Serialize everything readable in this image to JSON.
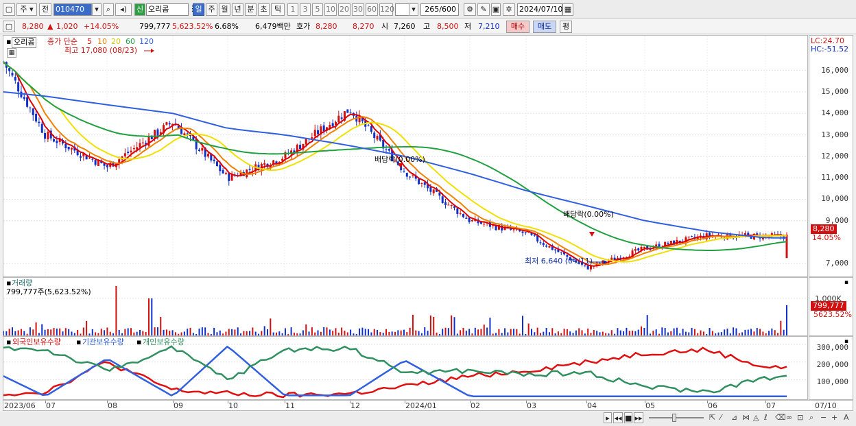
{
  "toolbar": {
    "period_mode": "주",
    "compare": "전",
    "stock_code": "010470",
    "new_badge": "신",
    "stock_name": "오리콤",
    "timeframes": [
      "일",
      "주",
      "월",
      "년",
      "분",
      "초",
      "틱"
    ],
    "minute_presets": [
      "1",
      "3",
      "5",
      "10",
      "20",
      "30",
      "60",
      "120"
    ],
    "count_display": "265",
    "count_total": "/600",
    "date": "2024/07/10"
  },
  "quote": {
    "price": "8,280",
    "change": "1,020",
    "change_pct": "+14.05%",
    "volume": "799,777",
    "volume_pct": "5,623.52%",
    "turnover_rate": "6.68%",
    "trade_value": "6,479백만",
    "ask_label": "호가",
    "ask": "8,280",
    "bid": "8,270",
    "open_label": "시",
    "open": "7,260",
    "high_label": "고",
    "high": "8,500",
    "low_label": "저",
    "low": "7,210",
    "buy_label": "매수",
    "sell_label": "매도",
    "eval_label": "평"
  },
  "price_panel": {
    "name": "오리콤",
    "ma_title": "종가 단순",
    "ma_periods": [
      "5",
      "10",
      "20",
      "60",
      "120"
    ],
    "high_annotation": "최고 17,080 (08/23)",
    "low_annotation": "최저 6,640 (04/11)",
    "dividend1": "배당락(0.00%)",
    "dividend2": "배당락(0.00%)",
    "lc_label": "LC:24.70",
    "hc_label": "HC:-51.52",
    "current_price_tag": "8,280",
    "current_pct_tag": "14.05%"
  },
  "volume_panel": {
    "title": "거래량",
    "summary": "799,777주(5,623.52%)",
    "axis_label": "1,000K",
    "tag_value": "799,777",
    "tag_pct": "5623.52%"
  },
  "holdings_panel": {
    "series_names": [
      "외국인보유수량",
      "기관보유수량",
      "개인보유수량"
    ],
    "axis_labels": [
      "300,000",
      "200,000",
      "100,000"
    ]
  },
  "x_axis": {
    "labels": [
      "2023/06",
      "07",
      "08",
      "09",
      "10",
      "11",
      "12",
      "2024/01",
      "02",
      "03",
      "04",
      "05",
      "06",
      "07"
    ],
    "end_label": "07/10"
  },
  "colors": {
    "up": "#d21010",
    "down": "#1030c8",
    "ma5": "#e00000",
    "ma10": "#f08000",
    "ma20": "#f0e000",
    "ma60": "#20a040",
    "ma120": "#3060e0",
    "foreign": "#e01010",
    "institution": "#3060e0",
    "individual": "#309060"
  },
  "chart_data": {
    "type": "line",
    "title": "오리콤",
    "x": [
      "2023/06",
      "07",
      "08",
      "09",
      "10",
      "11",
      "12",
      "2024/01",
      "02",
      "03",
      "04",
      "05",
      "06",
      "07"
    ],
    "price_close_approx": [
      16400,
      13000,
      11500,
      13600,
      11000,
      12000,
      14200,
      11300,
      9000,
      8400,
      6800,
      7700,
      8300,
      8280
    ],
    "ylim": [
      6500,
      17300
    ],
    "ma120_approx": [
      15000,
      14800,
      14400,
      14000,
      13300,
      13000,
      12500,
      12000,
      11200,
      10400,
      9700,
      9000,
      8500,
      8200
    ],
    "holdings": {
      "series": [
        {
          "name": "외국인보유수량",
          "values": [
            20000,
            30000,
            200000,
            40000,
            20000,
            10000,
            20000,
            60000,
            120000,
            150000,
            200000,
            250000,
            270000,
            170000
          ]
        },
        {
          "name": "기관보유수량",
          "values": [
            120000,
            5000,
            220000,
            5000,
            290000,
            10000,
            10000,
            210000,
            5000,
            5000,
            5000,
            5000,
            5000,
            5000
          ]
        },
        {
          "name": "개인보유수량",
          "values": [
            280000,
            270000,
            150000,
            280000,
            100000,
            270000,
            280000,
            140000,
            150000,
            130000,
            140000,
            60000,
            30000,
            110000
          ]
        }
      ],
      "ylim": [
        0,
        320000
      ]
    }
  }
}
